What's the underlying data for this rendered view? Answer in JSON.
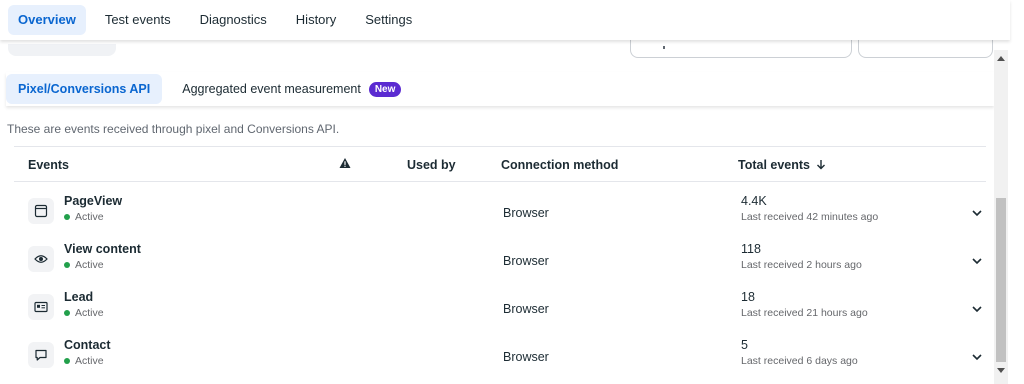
{
  "topnav": {
    "tabs": [
      {
        "label": "Overview",
        "active": true
      },
      {
        "label": "Test events"
      },
      {
        "label": "Diagnostics"
      },
      {
        "label": "History"
      },
      {
        "label": "Settings"
      }
    ]
  },
  "subtabs": {
    "tabs": [
      {
        "label": "Pixel/Conversions API",
        "active": true
      },
      {
        "label": "Aggregated event measurement",
        "badge": "New"
      }
    ]
  },
  "description": "These are events received through pixel and Conversions API.",
  "table": {
    "headers": {
      "events": "Events",
      "warning_icon": "warning-icon",
      "used_by": "Used by",
      "connection_method": "Connection method",
      "total_events": "Total events",
      "sort_icon": "arrow-down-icon"
    },
    "rows": [
      {
        "icon": "browser-window-icon",
        "name": "PageView",
        "status": "Active",
        "connection": "Browser",
        "total": "4.4K",
        "last_received": "Last received 42 minutes ago"
      },
      {
        "icon": "eye-icon",
        "name": "View content",
        "status": "Active",
        "connection": "Browser",
        "total": "118",
        "last_received": "Last received 2 hours ago"
      },
      {
        "icon": "id-card-icon",
        "name": "Lead",
        "status": "Active",
        "connection": "Browser",
        "total": "18",
        "last_received": "Last received 21 hours ago"
      },
      {
        "icon": "chat-bubble-icon",
        "name": "Contact",
        "status": "Active",
        "connection": "Browser",
        "total": "5",
        "last_received": "Last received 6 days ago"
      }
    ]
  },
  "colors": {
    "accent": "#0a66d0",
    "active_tab_bg": "#e7f0fd",
    "new_badge": "#5b2bd1",
    "status_active": "#22a04b"
  }
}
